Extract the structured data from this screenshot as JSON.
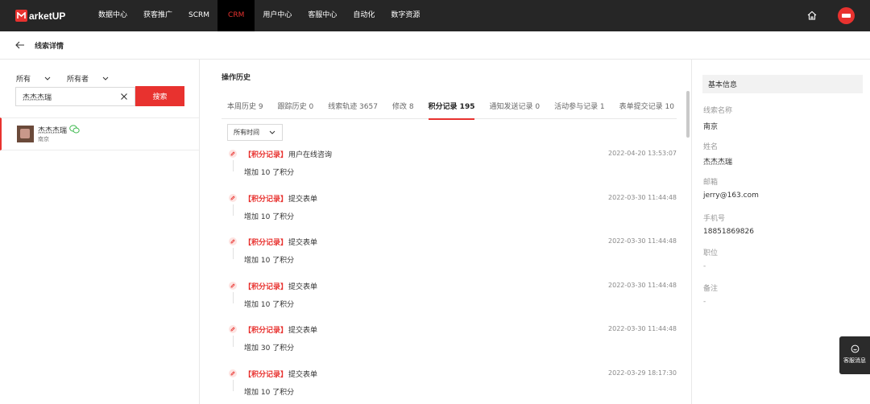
{
  "brand": {
    "logo_text": "arketUP",
    "accent": "#e8322f"
  },
  "topnav": {
    "items": [
      {
        "label": "数据中心"
      },
      {
        "label": "获客推广"
      },
      {
        "label": "SCRM"
      },
      {
        "label": "CRM"
      },
      {
        "label": "用户中心"
      },
      {
        "label": "客服中心"
      },
      {
        "label": "自动化"
      },
      {
        "label": "数字资源"
      }
    ],
    "active": "CRM"
  },
  "page": {
    "title": "线索详情"
  },
  "filters": {
    "scope": "所有",
    "owner": "所有者"
  },
  "search": {
    "value": "杰杰杰瑞",
    "button_label": "搜索"
  },
  "lead": {
    "name": "杰杰杰瑞",
    "city": "南京"
  },
  "history": {
    "section_title": "操作历史",
    "tabs": [
      {
        "label": "本周历史 9"
      },
      {
        "label": "跟踪历史 0"
      },
      {
        "label": "线索轨迹 3657"
      },
      {
        "label": "修改 8"
      },
      {
        "label": "积分记录 195"
      },
      {
        "label": "通知发送记录 0"
      },
      {
        "label": "活动参与记录 1"
      },
      {
        "label": "表单提交记录 10"
      }
    ],
    "active_tab": "积分记录 195",
    "time_filter": "所有时间",
    "records": [
      {
        "tag": "【积分记录】",
        "title": "用户在线咨询",
        "time": "2022-04-20 13:53:07",
        "desc": "增加 10 了积分"
      },
      {
        "tag": "【积分记录】",
        "title": "提交表单",
        "time": "2022-03-30 11:44:48",
        "desc": "增加 10 了积分"
      },
      {
        "tag": "【积分记录】",
        "title": "提交表单",
        "time": "2022-03-30 11:44:48",
        "desc": "增加 10 了积分"
      },
      {
        "tag": "【积分记录】",
        "title": "提交表单",
        "time": "2022-03-30 11:44:48",
        "desc": "增加 10 了积分"
      },
      {
        "tag": "【积分记录】",
        "title": "提交表单",
        "time": "2022-03-30 11:44:48",
        "desc": "增加 30 了积分"
      },
      {
        "tag": "【积分记录】",
        "title": "提交表单",
        "time": "2022-03-29 18:17:30",
        "desc": "增加 10 了积分"
      }
    ]
  },
  "basic_info": {
    "title": "基本信息",
    "fields": [
      {
        "label": "线索名称",
        "value": "南京"
      },
      {
        "label": "姓名",
        "value": "杰杰杰瑞"
      },
      {
        "label": "邮箱",
        "value": "jerry@163.com"
      },
      {
        "label": "手机号",
        "value": "18851869826"
      },
      {
        "label": "职位",
        "value": "-"
      },
      {
        "label": "备注",
        "value": "-"
      }
    ]
  },
  "service_widget": {
    "label": "客服消息"
  }
}
